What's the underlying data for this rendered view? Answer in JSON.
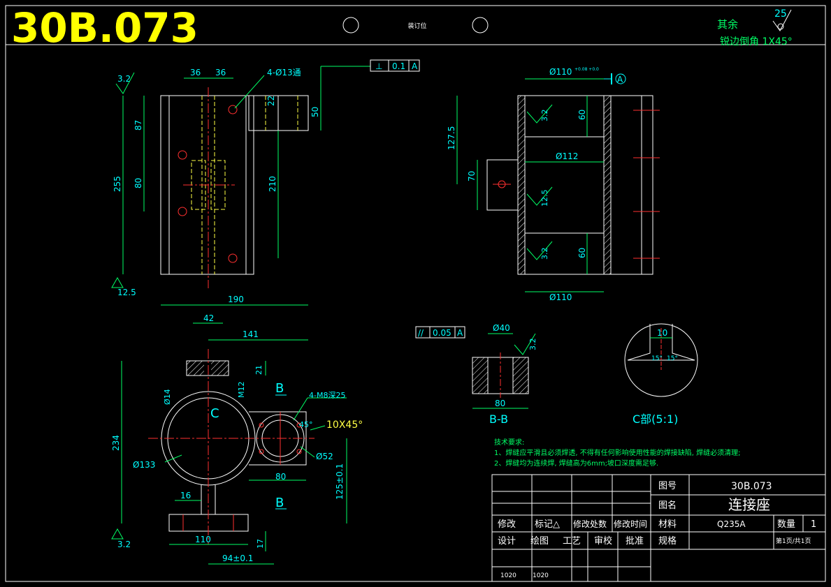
{
  "drawing_number_large": "30B.073",
  "binding_label": "装订位",
  "surface_note": {
    "label": "其余",
    "roughness": "25",
    "edge_chamfer": "锐边倒角 1X45°"
  },
  "colors": {
    "background": "#000000",
    "outline": "#ffffff",
    "dimension": "#00ff66",
    "dim_text": "#00ffff",
    "center": "#ff3030",
    "hidden": "#ffff44",
    "title_yellow": "#ffff00"
  },
  "top_view": {
    "roughness_top": "3.2",
    "roughness_bottom": "12.5",
    "dims": [
      "36",
      "36",
      "4-Ø13通",
      "22",
      "50",
      "87",
      "80",
      "255",
      "210"
    ],
    "perp_tol": [
      "⊥",
      "0.1",
      "A"
    ]
  },
  "side_view": {
    "dims": [
      "Ø110",
      "+0.08 +0.0",
      "Ø112",
      "127.5",
      "70",
      "60",
      "60",
      "Ø110"
    ],
    "roughness": [
      "3.2",
      "12.5",
      "3.2"
    ],
    "datum": "A"
  },
  "front_view": {
    "dims": [
      "190",
      "42",
      "141",
      "21",
      "M12",
      "Ø14",
      "234",
      "Ø133",
      "4-M8深25",
      "45°",
      "10X45°",
      "Ø52",
      "80",
      "125±0.1",
      "16",
      "110",
      "17",
      "94±0.1"
    ],
    "section_labels": [
      "B",
      "B"
    ],
    "detail_label": "C",
    "roughness_bottom": "3.2"
  },
  "section_bb": {
    "parallel_tol": [
      "//",
      "0.05",
      "A"
    ],
    "dims": [
      "Ø40",
      "80"
    ],
    "roughness": "3.2",
    "label": "B-B"
  },
  "detail_c": {
    "dims": [
      "10",
      "15°",
      "15°"
    ],
    "label": "C部(5:1)"
  },
  "tech_requirements": {
    "heading": "技术要求:",
    "items": [
      "1、焊缝应平滑且必须焊透, 不得有任何影响使用性能的焊接缺陷, 焊缝必须清理;",
      "2、焊缝均为连续焊, 焊缝高为6mm;坡口深度需足够."
    ]
  },
  "title_block": {
    "drawing_no_label": "图号",
    "drawing_no": "30B.073",
    "name_label": "图名",
    "name": "连接座",
    "material_label": "材料",
    "material": "Q235A",
    "qty_label": "数量",
    "qty": "1",
    "spec_label": "规格",
    "page": "第1页/共1页",
    "rev_headers": [
      "修改",
      "标记△",
      "修改处数",
      "修改时间"
    ],
    "sign_headers": [
      "设计",
      "绘图",
      "工艺",
      "审校",
      "批准"
    ],
    "sign_values": [
      "1020",
      "1020"
    ]
  }
}
